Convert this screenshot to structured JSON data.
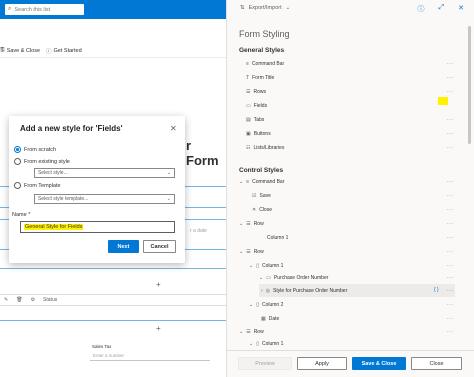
{
  "search": {
    "placeholder": "Search this list"
  },
  "command_bar": {
    "save_close": "Save & Close",
    "get_started": "Get Started"
  },
  "form_background": {
    "title_fragment": "r Form",
    "date_hint": "r a date",
    "status_field": "Status",
    "sales_tax_label": "Sales Tax",
    "sales_tax_placeholder": "Enter a number"
  },
  "dialog": {
    "title": "Add a new style for 'Fields'",
    "options": {
      "from_scratch": "From scratch",
      "from_existing": "From existing style",
      "from_template": "From Template"
    },
    "select_style_placeholder": "Select style...",
    "select_template_placeholder": "Select style template...",
    "name_label": "Name *",
    "name_value": "General Style for Fields",
    "next_button": "Next",
    "cancel_button": "Cancel"
  },
  "panel": {
    "breadcrumb": "Export/Import",
    "title": "Form Styling",
    "general_styles": {
      "title": "General Styles",
      "items": [
        "Command Bar",
        "Form Title",
        "Rows",
        "Fields",
        "Tabs",
        "Buttons",
        "Lists/Libraries"
      ]
    },
    "control_styles": {
      "title": "Control Styles",
      "items": {
        "command_bar": "Command Bar",
        "save": "Save",
        "close": "Close",
        "row1": "Row",
        "column1a": "Column 1",
        "row2": "Row",
        "column1b": "Column 1",
        "po_number": "Purchase Order Number",
        "style_po": "Style for Purchase Order Number",
        "column2": "Column 2",
        "date": "Date",
        "row3": "Row",
        "column1c": "Column 1"
      }
    },
    "footer": {
      "preview": "Preview",
      "apply": "Apply",
      "save_close": "Save & Close",
      "close": "Close"
    }
  },
  "colors": {
    "accent": "#0078d4",
    "highlight": "#fff100"
  }
}
